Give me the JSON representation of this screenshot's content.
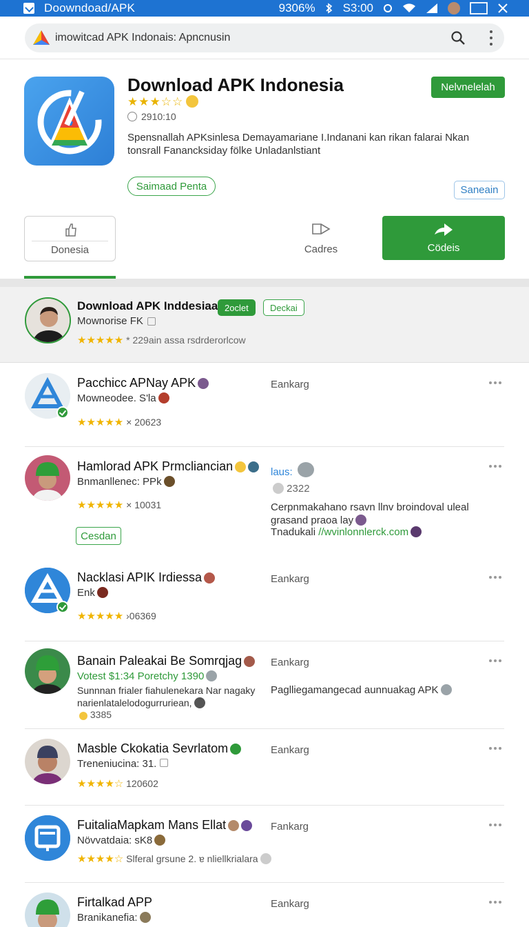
{
  "statusbar": {
    "title": "Doowndoad/​APK",
    "battery": "9306%",
    "time": "S3:00"
  },
  "search": {
    "value": "imowitcad APK Indonais: Apncnusin"
  },
  "app": {
    "title": "Download APK Indonesia",
    "stars": "★★★☆☆",
    "downloads": "2910:10",
    "description": "Spensnallah APKsinlesa Demayamariane I.Indanani kan rikan falarai Nkan tonsrall Fanancksiday fölke Unladanlstiant",
    "install_label": "Nelvnelelah",
    "pill_green": "Saimaad Penta",
    "pill_blue": "Saneain"
  },
  "actions": {
    "left_label": "Donesia",
    "mid_label": "Cadres",
    "right_label": "Cödeis"
  },
  "featured": {
    "name": "Download APK Inddesiaa",
    "chip_solid": "2oclet",
    "chip_outline": "Deckai",
    "sub": "Mownorise FK",
    "stars": "★★★★★",
    "rating_text": "* 229ain assa rsdrderorlcow"
  },
  "rows": [
    {
      "name": "Pacchicc APNay APK",
      "sub": "Mowneodee. S'la",
      "stars": "★★★★★",
      "rating_text": "× 20623",
      "right": "Eankarg"
    },
    {
      "name": "Hamlorad APK Prmcliancian",
      "sub": "Bnmanllenec: PPk",
      "stars": "★★★★★",
      "rating_text": "× 10031",
      "right": "laus:",
      "right_count": "2322",
      "right_desc": "Cerpnmakahano rsavn llnv broindoval uleal grasand praoa lay",
      "right_link_prefix": "Tnadukali",
      "right_link": "//wvinlonnlerck.com",
      "button": "Cesdan"
    },
    {
      "name": "Nacklasi APIK Irdiessa",
      "sub": "Enk",
      "stars": "★★★★★",
      "rating_text": "›06369",
      "right": "Eankarg"
    },
    {
      "name": "Banain Paleakai Be Somrqjag",
      "sub_green": "Votest $1:34 Poretchy 1390",
      "desc": "Sunnnan frialer fiahulenekara Nar nagaky narienlatalelodogurruriean,",
      "count": "3385",
      "right": "Eankarg",
      "right_desc": "Paglliegamangecad aunnuakag APK"
    },
    {
      "name": "Masble Ckokatia Sevrlatom",
      "sub": "Treneniucina: 31.",
      "stars": "★★★★☆",
      "rating_text": "120602",
      "right": "Eankarg"
    },
    {
      "name": "FuitaliaMapkam Mans Ellat",
      "sub": "Növvatdaia: sK8",
      "stars": "★★★★☆",
      "rating_text": "Slferal grsune 2. ɐ nliellkrialara",
      "right": "Fankarg"
    },
    {
      "name": "Firtalkad APP",
      "sub": "Branikanefia:",
      "right": "Eankarg"
    }
  ]
}
